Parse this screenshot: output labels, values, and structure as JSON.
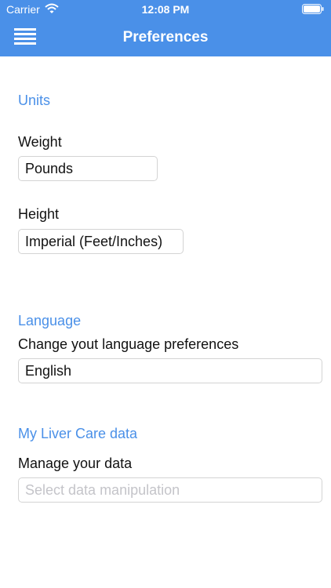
{
  "status_bar": {
    "carrier": "Carrier",
    "time": "12:08 PM"
  },
  "header": {
    "title": "Preferences",
    "menu_icon": "hamburger-menu-icon",
    "background_color": "#4a90e8"
  },
  "units": {
    "section_title": "Units",
    "weight": {
      "label": "Weight",
      "value": "Pounds"
    },
    "height": {
      "label": "Height",
      "value": "Imperial (Feet/Inches)"
    }
  },
  "language": {
    "section_title": "Language",
    "label": "Change yout language preferences",
    "value": "English"
  },
  "data": {
    "section_title": "My Liver Care data",
    "label": "Manage your data",
    "placeholder": "Select data manipulation"
  },
  "colors": {
    "accent": "#4a90e8",
    "text": "#111111",
    "placeholder": "#c4c4c9",
    "border": "#d3d3d3"
  }
}
